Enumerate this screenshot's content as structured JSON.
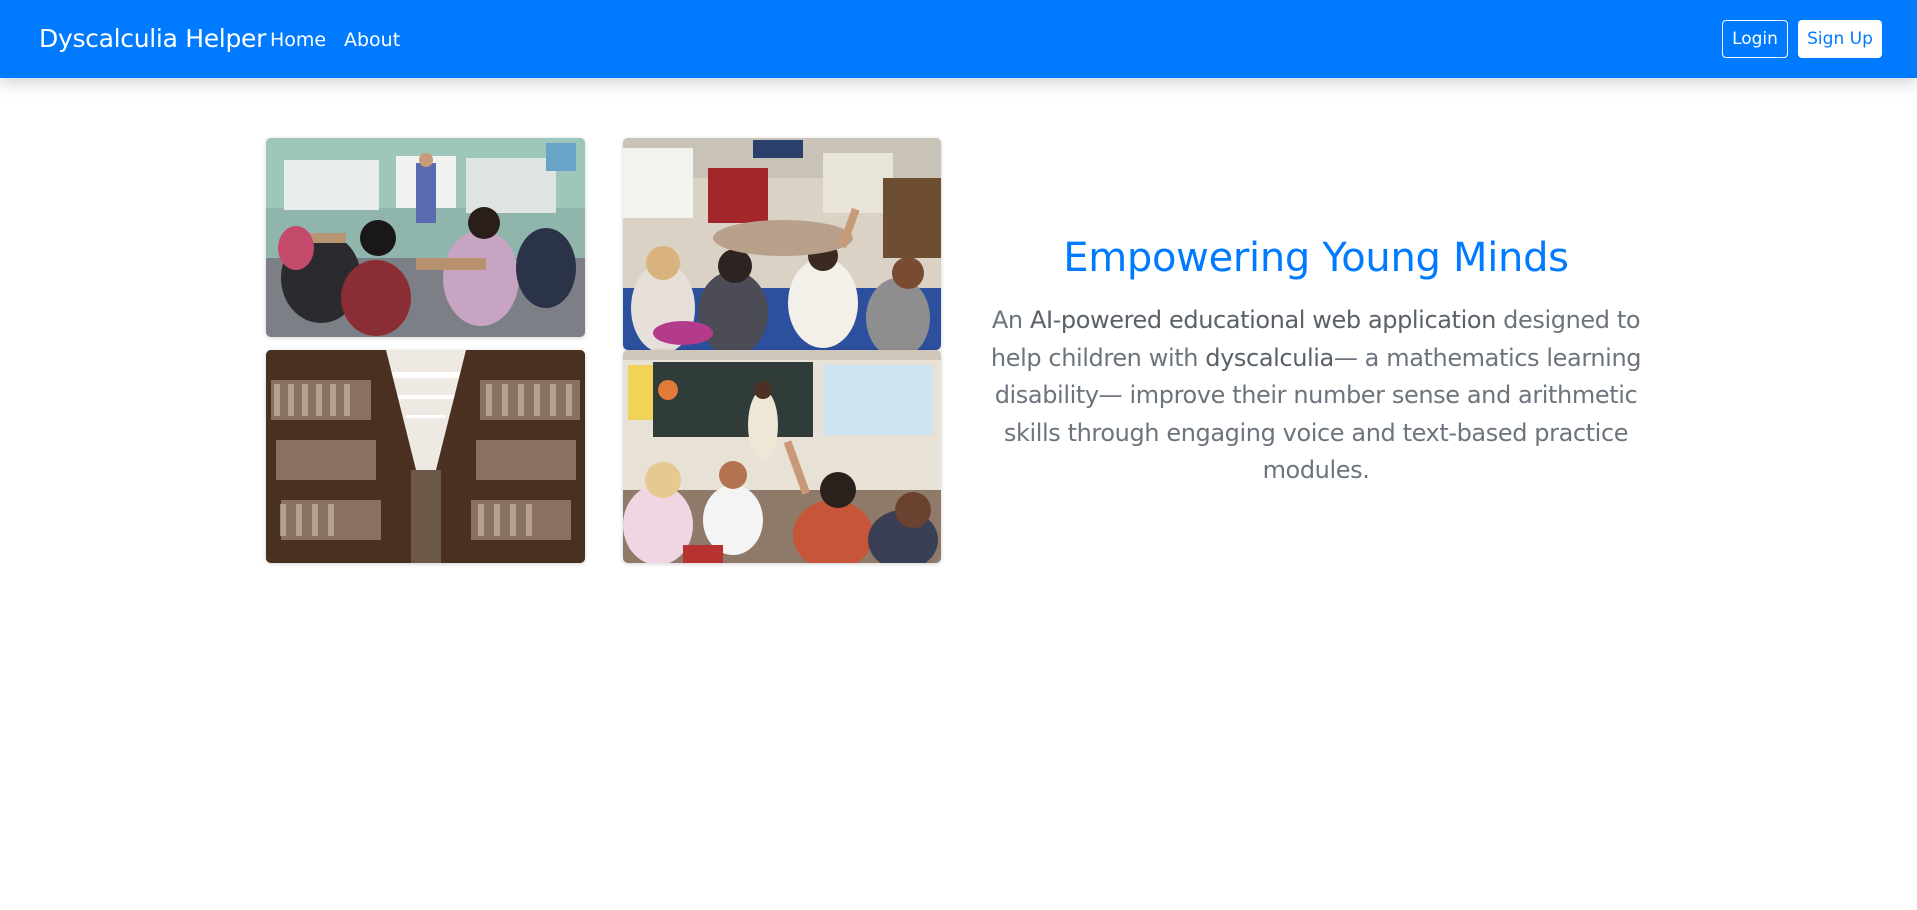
{
  "navbar": {
    "brand": "Dyscalculia Helper",
    "links": [
      {
        "label": "Home"
      },
      {
        "label": "About"
      }
    ],
    "login_label": "Login",
    "signup_label": "Sign Up"
  },
  "gallery": {
    "images": [
      {
        "name": "classroom-students-teacher-photo"
      },
      {
        "name": "children-raising-hands-photo"
      },
      {
        "name": "library-bookshelves-photo"
      },
      {
        "name": "teacher-chalkboard-classroom-photo"
      }
    ]
  },
  "hero": {
    "title": "Empowering Young Minds",
    "text_1": "An ",
    "highlight_1": "AI-powered educational web application",
    "text_2": " designed to help children with ",
    "highlight_2": "dyscalculia",
    "text_3": "— a mathematics learning disability— improve their number sense and arithmetic skills through engaging voice and text-based practice modules."
  },
  "colors": {
    "primary": "#007bff",
    "muted_text": "#6c757d",
    "background": "#ffffff"
  }
}
